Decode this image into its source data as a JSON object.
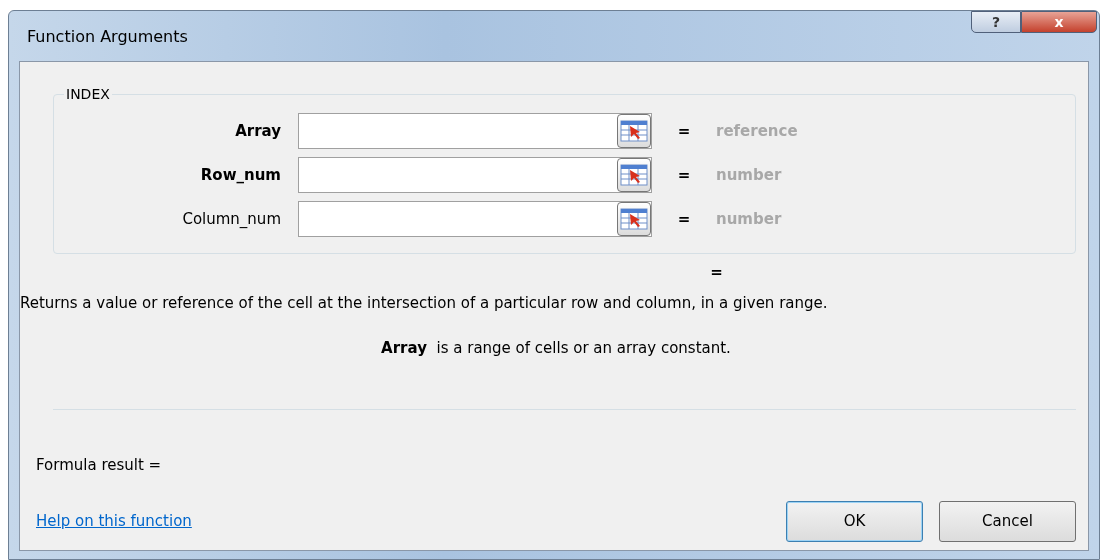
{
  "window": {
    "title": "Function Arguments",
    "help_button": "?",
    "close_button": "x"
  },
  "function_group": {
    "legend": "INDEX",
    "arguments": [
      {
        "label": "Array",
        "required": true,
        "equals": "=",
        "value_hint": "reference"
      },
      {
        "label": "Row_num",
        "required": true,
        "equals": "=",
        "value_hint": "number"
      },
      {
        "label": "Column_num",
        "required": false,
        "equals": "=",
        "value_hint": "number"
      }
    ]
  },
  "result_equals": "=",
  "description": "Returns a value or reference of the cell at the intersection of a particular row and column, in a given range.",
  "argument_help": {
    "name": "Array",
    "text": "is a range of cells or an array constant."
  },
  "formula_result": "Formula result =",
  "help_link": "Help on this function",
  "buttons": [
    {
      "label": "OK",
      "default": true
    },
    {
      "label": "Cancel",
      "default": false
    }
  ]
}
